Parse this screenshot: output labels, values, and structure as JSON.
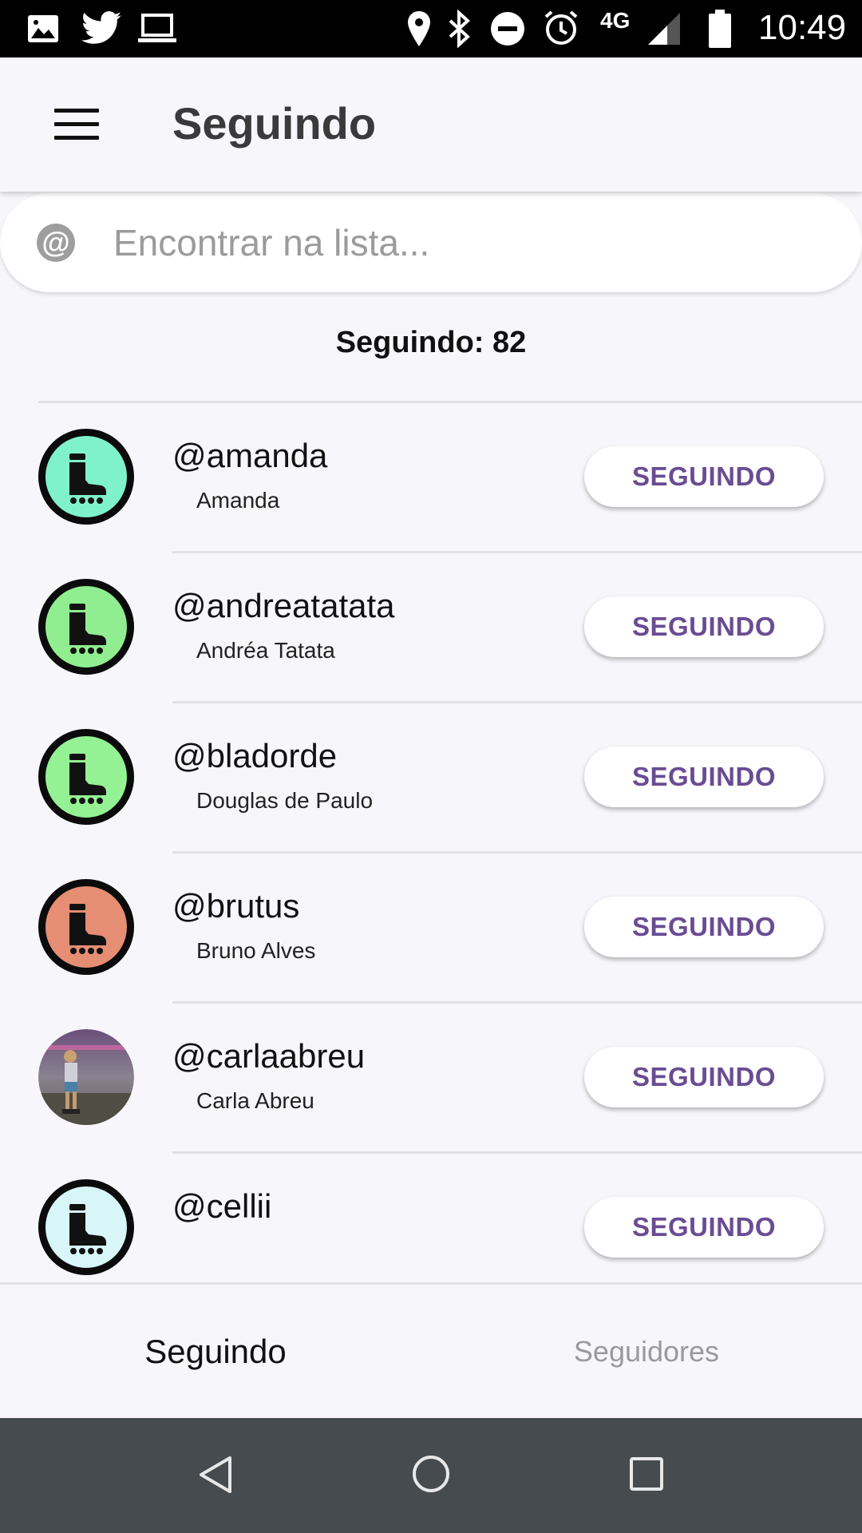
{
  "status_bar": {
    "network": "4G",
    "time": "10:49",
    "icons": [
      "gallery-icon",
      "twitter-icon",
      "laptop-icon",
      "location-icon",
      "bluetooth-icon",
      "do-not-disturb-icon",
      "alarm-icon",
      "signal-icon",
      "battery-icon"
    ]
  },
  "header": {
    "title": "Seguindo",
    "menu_icon": "hamburger-menu-icon"
  },
  "search": {
    "icon": "at-icon",
    "icon_glyph": "@",
    "placeholder": "Encontrar na lista...",
    "value": ""
  },
  "count_label": "Seguindo: 82",
  "users": [
    {
      "handle": "@amanda",
      "name": "Amanda",
      "avatar": "skate-icon",
      "avatar_color": "#7ff2cc",
      "button": "SEGUINDO"
    },
    {
      "handle": "@andreatatata",
      "name": "Andréa Tatata",
      "avatar": "skate-icon",
      "avatar_color": "#90ee90",
      "button": "SEGUINDO"
    },
    {
      "handle": "@bladorde",
      "name": "Douglas de Paulo",
      "avatar": "skate-icon",
      "avatar_color": "#95f294",
      "button": "SEGUINDO"
    },
    {
      "handle": "@brutus",
      "name": "Bruno Alves",
      "avatar": "skate-icon",
      "avatar_color": "#e58e73",
      "button": "SEGUINDO"
    },
    {
      "handle": "@carlaabreu",
      "name": "Carla Abreu",
      "avatar": "profile-photo",
      "avatar_color": "#6f6a78",
      "button": "SEGUINDO"
    },
    {
      "handle": "@cellii",
      "name": "",
      "avatar": "skate-icon",
      "avatar_color": "#d8f6f8",
      "button": "SEGUINDO"
    }
  ],
  "tabs": [
    {
      "label": "Seguindo",
      "active": true
    },
    {
      "label": "Seguidores",
      "active": false
    }
  ],
  "nav_bar": {
    "icons": [
      "back-icon",
      "home-icon",
      "recents-icon"
    ]
  },
  "colors": {
    "accent": "#6a4c93",
    "background": "#f7f7fb",
    "status_bar": "#000000",
    "nav_bar": "#464b50"
  }
}
